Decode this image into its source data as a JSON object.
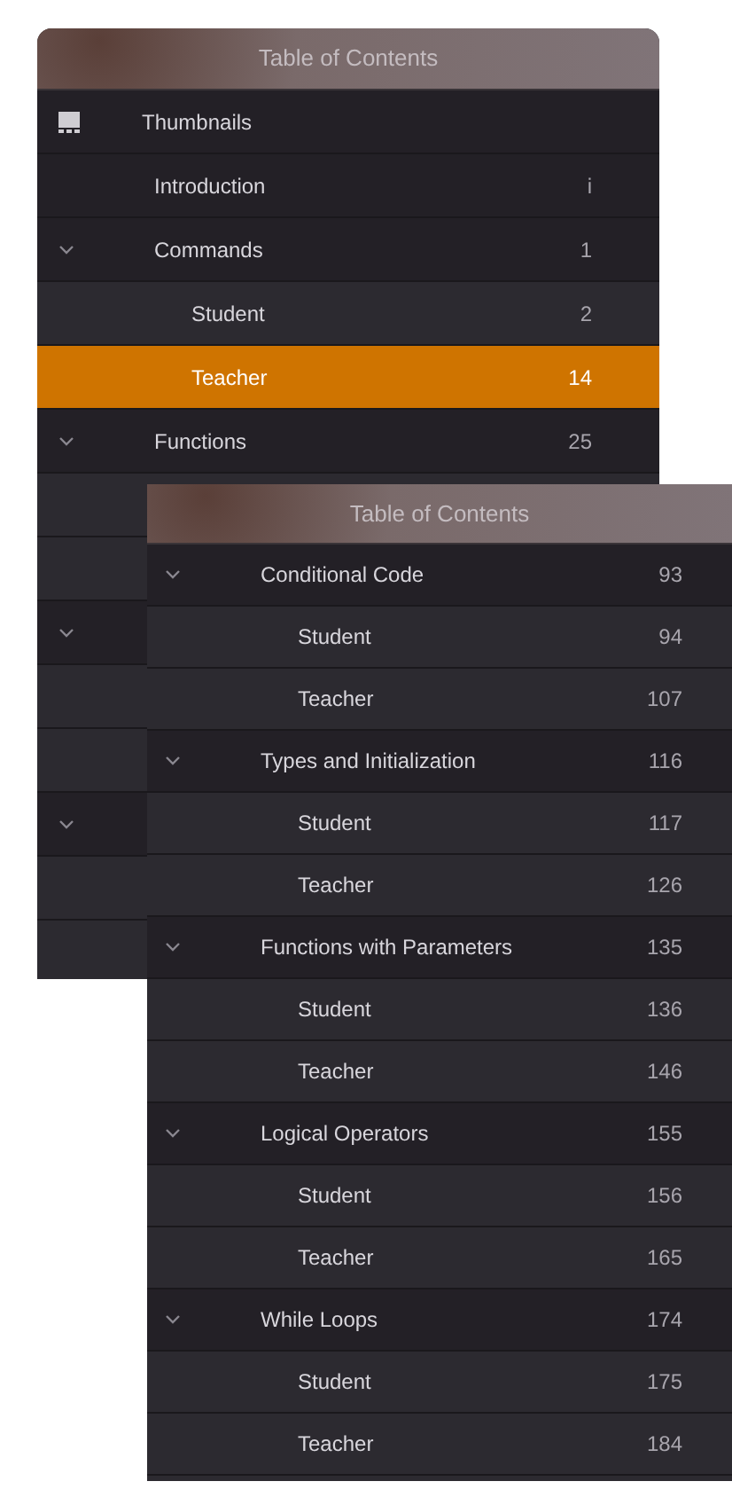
{
  "windows": [
    {
      "title": "Table of Contents",
      "items": [
        {
          "kind": "thumbnails",
          "title": "Thumbnails",
          "selected": false
        },
        {
          "kind": "leaf",
          "title": "Introduction",
          "page": "i",
          "selected": false
        },
        {
          "kind": "chapter",
          "title": "Commands",
          "page": "1",
          "expanded": true,
          "selected": false
        },
        {
          "kind": "section",
          "title": "Student",
          "page": "2",
          "selected": false
        },
        {
          "kind": "section",
          "title": "Teacher",
          "page": "14",
          "selected": true
        },
        {
          "kind": "chapter",
          "title": "Functions",
          "page": "25",
          "expanded": true,
          "selected": false
        },
        {
          "kind": "section",
          "selected": false
        },
        {
          "kind": "section",
          "selected": false
        },
        {
          "kind": "chapter",
          "expanded": true,
          "selected": false
        },
        {
          "kind": "section",
          "selected": false
        },
        {
          "kind": "section",
          "selected": false
        },
        {
          "kind": "chapter",
          "expanded": true,
          "selected": false
        },
        {
          "kind": "section",
          "selected": false
        }
      ]
    },
    {
      "title": "Table of Contents",
      "items": [
        {
          "kind": "chapter",
          "title": "Conditional Code",
          "page": "93",
          "expanded": true,
          "selected": false
        },
        {
          "kind": "section",
          "title": "Student",
          "page": "94",
          "selected": false
        },
        {
          "kind": "section",
          "title": "Teacher",
          "page": "107",
          "selected": false
        },
        {
          "kind": "chapter",
          "title": "Types and Initialization",
          "page": "116",
          "expanded": true,
          "selected": false
        },
        {
          "kind": "section",
          "title": "Student",
          "page": "117",
          "selected": false
        },
        {
          "kind": "section",
          "title": "Teacher",
          "page": "126",
          "selected": false
        },
        {
          "kind": "chapter",
          "title": "Functions with Parameters",
          "page": "135",
          "expanded": true,
          "selected": false
        },
        {
          "kind": "section",
          "title": "Student",
          "page": "136",
          "selected": false
        },
        {
          "kind": "section",
          "title": "Teacher",
          "page": "146",
          "selected": false
        },
        {
          "kind": "chapter",
          "title": "Logical Operators",
          "page": "155",
          "expanded": true,
          "selected": false
        },
        {
          "kind": "section",
          "title": "Student",
          "page": "156",
          "selected": false
        },
        {
          "kind": "section",
          "title": "Teacher",
          "page": "165",
          "selected": false
        },
        {
          "kind": "chapter",
          "title": "While Loops",
          "page": "174",
          "expanded": true,
          "selected": false
        },
        {
          "kind": "section",
          "title": "Student",
          "page": "175",
          "selected": false
        },
        {
          "kind": "section",
          "title": "Teacher",
          "page": "184",
          "selected": false
        }
      ]
    }
  ]
}
